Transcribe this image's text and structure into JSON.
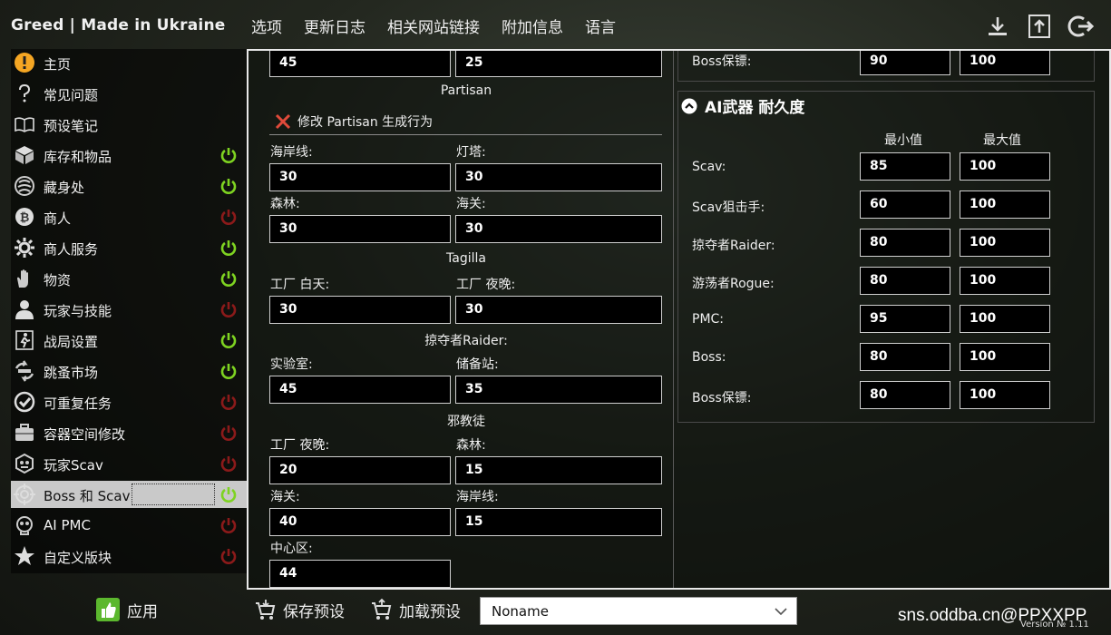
{
  "app": {
    "title": "Greed | Made in Ukraine"
  },
  "menu": {
    "items": [
      "选项",
      "更新日志",
      "相关网站链接",
      "附加信息",
      "语言"
    ]
  },
  "top_icons": [
    "download-icon",
    "upload-icon",
    "logout-icon"
  ],
  "sidebar": {
    "items": [
      {
        "label": "主页",
        "icon": "warning-icon",
        "toggle": null
      },
      {
        "label": "常见问题",
        "icon": "question-icon",
        "toggle": null
      },
      {
        "label": "预设笔记",
        "icon": "book-icon",
        "toggle": null
      },
      {
        "label": "库存和物品",
        "icon": "box-icon",
        "toggle": "on"
      },
      {
        "label": "藏身处",
        "icon": "hideout-icon",
        "toggle": "on"
      },
      {
        "label": "商人",
        "icon": "bitcoin-icon",
        "toggle": "off"
      },
      {
        "label": "商人服务",
        "icon": "gear-icon",
        "toggle": "on"
      },
      {
        "label": "物资",
        "icon": "hand-icon",
        "toggle": "on"
      },
      {
        "label": "玩家与技能",
        "icon": "user-icon",
        "toggle": "off"
      },
      {
        "label": "战局设置",
        "icon": "exit-icon",
        "toggle": "on"
      },
      {
        "label": "跳蚤市场",
        "icon": "exchange-icon",
        "toggle": "on"
      },
      {
        "label": "可重复任务",
        "icon": "check-icon",
        "toggle": "off"
      },
      {
        "label": "容器空间修改",
        "icon": "briefcase-icon",
        "toggle": "off"
      },
      {
        "label": "玩家Scav",
        "icon": "scav-icon",
        "toggle": "off"
      },
      {
        "label": "Boss 和 Scav",
        "icon": "crosshair-icon",
        "toggle": "on",
        "active": true
      },
      {
        "label": "AI PMC",
        "icon": "skull-icon",
        "toggle": "off"
      },
      {
        "label": "自定义版块",
        "icon": "star-icon",
        "toggle": "off"
      }
    ]
  },
  "left": {
    "top_fields": [
      "45",
      "25"
    ],
    "partisan_title": "Partisan",
    "partisan_toggle": "修改 Partisan 生成行为",
    "shoreline_label": "海岸线:",
    "shoreline_value": "30",
    "lighthouse_label": "灯塔:",
    "lighthouse_value": "30",
    "woods_label": "森林:",
    "woods_value": "30",
    "customs_label": "海关:",
    "customs_value": "30",
    "tagilla_title": "Tagilla",
    "factory_day_label": "工厂 白天:",
    "factory_day_value": "30",
    "factory_night_label": "工厂 夜晚:",
    "factory_night_value": "30",
    "raider_title": "掠夺者Raider:",
    "lab_label": "实验室:",
    "lab_value": "45",
    "reserve_label": "储备站:",
    "reserve_value": "35",
    "cultist_title": "邪教徒",
    "c_factory_night_label": "工厂 夜晚:",
    "c_factory_night_value": "20",
    "c_woods_label": "森林:",
    "c_woods_value": "15",
    "c_customs_label": "海关:",
    "c_customs_value": "40",
    "c_shoreline_label": "海岸线:",
    "c_shoreline_value": "15",
    "c_center_label": "中心区:",
    "c_center_value": "44"
  },
  "right": {
    "top_row": {
      "label": "Boss保镖:",
      "min": "90",
      "max": "100"
    },
    "weapon_section": {
      "title": "AI武器 耐久度",
      "min_header": "最小值",
      "max_header": "最大值",
      "rows": [
        {
          "label": "Scav:",
          "min": "85",
          "max": "100"
        },
        {
          "label": "Scav狙击手:",
          "min": "60",
          "max": "100"
        },
        {
          "label": "掠夺者Raider:",
          "min": "80",
          "max": "100"
        },
        {
          "label": "游荡者Rogue:",
          "min": "80",
          "max": "100"
        },
        {
          "label": "PMC:",
          "min": "95",
          "max": "100"
        },
        {
          "label": "Boss:",
          "min": "80",
          "max": "100"
        },
        {
          "label": "Boss保镖:",
          "min": "80",
          "max": "100"
        }
      ]
    }
  },
  "bottom": {
    "apply_label": "应用",
    "save_label": "保存预设",
    "load_label": "加载预设",
    "preset_value": "Noname",
    "watermark": "sns.oddba.cn@PPXXPP",
    "version": "Version № 1.11"
  },
  "colors": {
    "on": "#7ed321",
    "off": "#8b1a1a",
    "accent_warning": "#f5a623",
    "apply_green": "#5cb82e"
  }
}
